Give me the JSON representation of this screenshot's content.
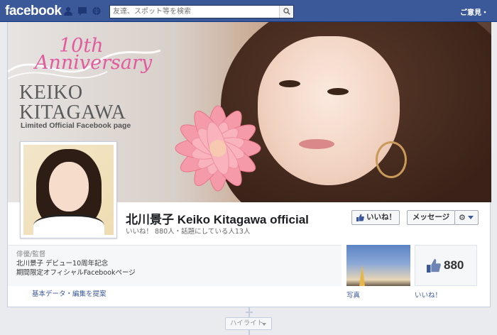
{
  "topbar": {
    "logo": "facebook",
    "search_placeholder": "友達、スポット等を検索",
    "right_text": "ご意見・"
  },
  "cover": {
    "anniversary_number": "10th",
    "anniversary_word": "Anniversary",
    "name_line1": "KEIKO",
    "name_line2": "KITAGAWA",
    "subtitle": "Limited Official Facebook page"
  },
  "page": {
    "title": "北川景子 Keiko Kitagawa official",
    "stats": "いいね！ 880人・話題にしている人13人"
  },
  "actions": {
    "like_label": "いいね！",
    "message_label": "メッセージ",
    "gear_label": "⚙"
  },
  "about": {
    "category": "俳優/監督",
    "line1": "北川景子 デビュー10周年記念",
    "line2": "期間限定オフィシャルFacebookページ",
    "link": "基本データ・編集を提案"
  },
  "tiles": {
    "photo_label": "写真",
    "likes_count": "880",
    "likes_label": "いいね！"
  },
  "timeline": {
    "highlight_label": "ハイライト"
  },
  "colors": {
    "brand": "#3b5998",
    "accent_pink": "#e25b9e"
  }
}
